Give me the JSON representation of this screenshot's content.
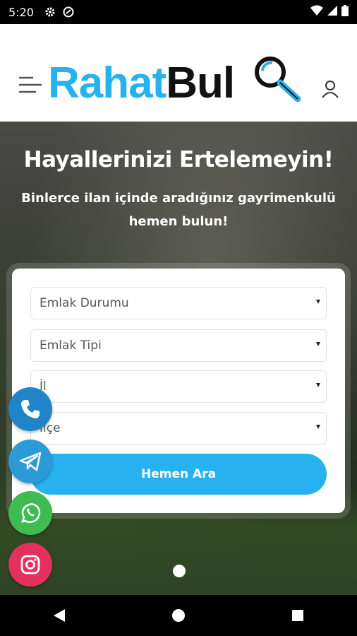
{
  "status_bar": {
    "time": "5:20",
    "icons": [
      "gear-icon",
      "no-disturb-icon",
      "wifi-icon",
      "signal-icon",
      "battery-icon"
    ]
  },
  "header": {
    "logo": {
      "part1": "Rahat",
      "part2": "Bul",
      "colors": {
        "primary": "#27b2ef",
        "dark": "#111111"
      }
    },
    "menu_icon": "hamburger-icon",
    "user_icon": "user-icon"
  },
  "hero": {
    "title": "Hayallerinizi Ertelemeyin!",
    "subtitle_line1": "Binlerce ilan içinde aradığınız gayrimenkulü",
    "subtitle_line2": "hemen bulun!"
  },
  "search_form": {
    "emlak_durumu": "Emlak Durumu",
    "emlak_tipi": "Emlak Tipi",
    "il": "İl",
    "ilce": "İlçe",
    "button": "Hemen Ara"
  },
  "contact_buttons": [
    "phone-icon",
    "telegram-icon",
    "whatsapp-icon",
    "instagram-icon"
  ],
  "colors": {
    "accent": "#27b2ef",
    "phone": "#1f85c8",
    "telegram": "#2d9ad8",
    "whatsapp": "#3fbb52",
    "instagram": "#e3305f"
  }
}
